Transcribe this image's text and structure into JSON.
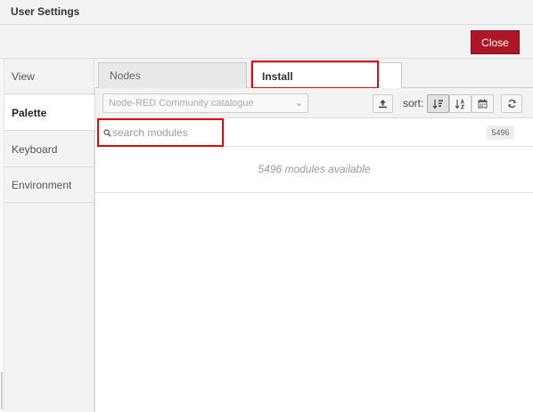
{
  "window": {
    "title": "User Settings"
  },
  "actions": {
    "close_label": "Close"
  },
  "sidebar": {
    "items": [
      {
        "label": "View"
      },
      {
        "label": "Palette"
      },
      {
        "label": "Keyboard"
      },
      {
        "label": "Environment"
      }
    ],
    "active": "Palette"
  },
  "tabs": [
    {
      "label": "Nodes"
    },
    {
      "label": "Install"
    }
  ],
  "toolbar": {
    "catalog_value": "Node-RED Community catalogue",
    "sort_label": "sort:"
  },
  "search": {
    "placeholder": "search modules",
    "count": "5496"
  },
  "results": {
    "summary": "5496 modules available"
  },
  "icons": {
    "upload": "upload-icon",
    "sort_relevance": "sort-relevance-icon",
    "sort_alpha": "sort-alpha-icon",
    "sort_date": "calendar-icon",
    "refresh": "refresh-icon",
    "search": "search-icon",
    "chevron": "chevron-down-icon"
  },
  "colors": {
    "close_button": "#ad1625",
    "highlight": "#dd0b0b"
  }
}
